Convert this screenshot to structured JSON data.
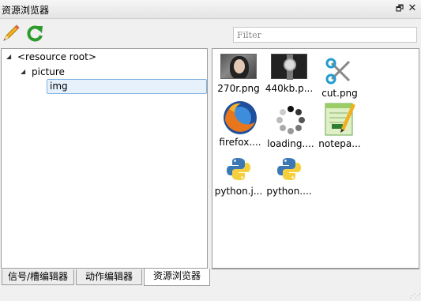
{
  "window": {
    "title": "资源浏览器",
    "float_icon": "float-icon",
    "close_icon": "close-icon"
  },
  "toolbar": {
    "edit_icon": "pencil-icon",
    "refresh_icon": "refresh-icon",
    "filter_placeholder": "Filter"
  },
  "tree": {
    "root": {
      "label": "<resource root>"
    },
    "picture": {
      "label": "picture"
    },
    "img": {
      "label": "img"
    }
  },
  "files": [
    {
      "name": "270r.png",
      "icon": "photo-thumbnail"
    },
    {
      "name": "440kb.p...",
      "icon": "watch-thumbnail"
    },
    {
      "name": "cut.png",
      "icon": "scissors-icon"
    },
    {
      "name": "firefox....",
      "icon": "firefox-icon"
    },
    {
      "name": "loading....",
      "icon": "loading-spinner-icon"
    },
    {
      "name": "notepa...",
      "icon": "notepad-icon"
    },
    {
      "name": "python.j...",
      "icon": "python-icon"
    },
    {
      "name": "python....",
      "icon": "python-icon"
    }
  ],
  "tabs": [
    {
      "label": "信号/槽编辑器",
      "active": false
    },
    {
      "label": "动作编辑器",
      "active": false
    },
    {
      "label": "资源浏览器",
      "active": true
    }
  ],
  "colors": {
    "selection_bg": "#e6f1fb",
    "selection_border": "#7fb2e0",
    "panel_border": "#9b9b9b"
  }
}
